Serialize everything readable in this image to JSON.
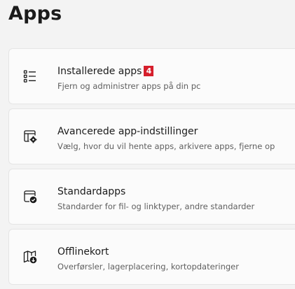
{
  "page": {
    "title": "Apps"
  },
  "items": [
    {
      "title": "Installerede apps",
      "badge": "4",
      "description": "Fjern og administrer apps på din pc",
      "icon": "list-icon"
    },
    {
      "title": "Avancerede app-indstillinger",
      "description": "Vælg, hvor du vil hente apps, arkivere apps, fjerne op",
      "icon": "app-settings-gear-icon"
    },
    {
      "title": "Standardapps",
      "description": "Standarder for fil- og linktyper, andre standarder",
      "icon": "default-apps-check-icon"
    },
    {
      "title": "Offlinekort",
      "description": "Overførsler, lagerplacering, kortopdateringer",
      "icon": "offline-map-icon"
    }
  ],
  "colors": {
    "background": "#f3f3f3",
    "card": "#fbfbfb",
    "badge": "#d61f2c"
  }
}
